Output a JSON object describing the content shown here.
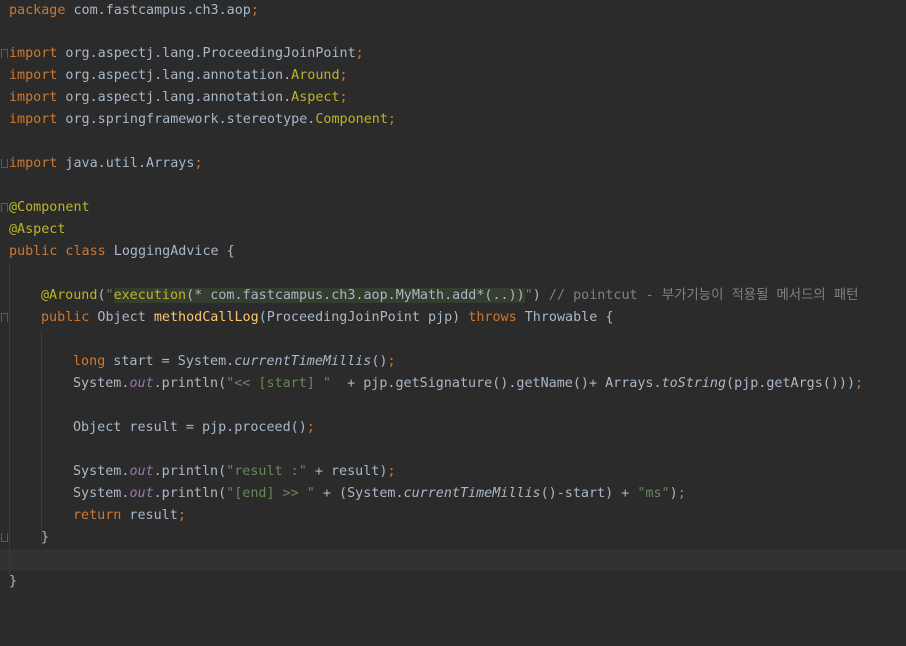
{
  "editor": {
    "language": "java",
    "colors": {
      "background": "#2b2b2b",
      "keyword": "#cc7832",
      "annotation": "#bbb529",
      "string": "#6a8759",
      "comment": "#808080",
      "field": "#9876aa",
      "method_decl": "#ffc66d",
      "plain": "#a9b7c6"
    },
    "code": {
      "pkg_kw": "package",
      "pkg_name": " com.fastcampus.ch3.aop",
      "semi": ";",
      "imp_kw": "import",
      "i1_path": " org.aspectj.lang.ProceedingJoinPoint",
      "i2_path": " org.aspectj.lang.annotation.",
      "i2_cls": "Around",
      "i3_path": " org.aspectj.lang.annotation.",
      "i3_cls": "Aspect",
      "i4_path": " org.springframework.stereotype.",
      "i4_cls": "Component",
      "i5_path": " java.util.Arrays",
      "ann_component": "@Component",
      "ann_aspect": "@Aspect",
      "public_kw": "public",
      "class_kw": " class",
      "class_name": " LoggingAdvice {",
      "around_ann": "@Around",
      "paren_open": "(",
      "quote": "\"",
      "pc_exec": "execution",
      "pc_body": "(* com.fastcampus.ch3.aop.MyMath.add*(..))",
      "paren_close": ")",
      "comment": " // pointcut - 부가기능이 적용될 메서드의 패턴",
      "obj_type": " Object ",
      "method_name": "methodCallLog",
      "params": "(ProceedingJoinPoint pjp) ",
      "throws_kw": "throws",
      "throwable": " Throwable {",
      "long_kw": "long",
      "start_decl": " start = System.",
      "ctm": "currentTimeMillis",
      "call_end": "()",
      "system": "System.",
      "out": "out",
      "println": ".println(",
      "str_start": "\"<< [start] \"",
      "p2_rest": "  + pjp.getSignature().getName()+ Arrays.",
      "to_string": "toString",
      "p2_args": "(pjp.getArgs()))",
      "obj_result": "Object result = pjp.proceed()",
      "str_result": "\"result :\"",
      "plus_result": " + result)",
      "str_end": "\"[end] >> \"",
      "plus_paren": " + (System.",
      "minus_start": "()-start) + ",
      "str_ms": "\"ms\"",
      "close_paren": ")",
      "return_kw": "return",
      "result_var": " result",
      "close_brace": "}"
    }
  }
}
